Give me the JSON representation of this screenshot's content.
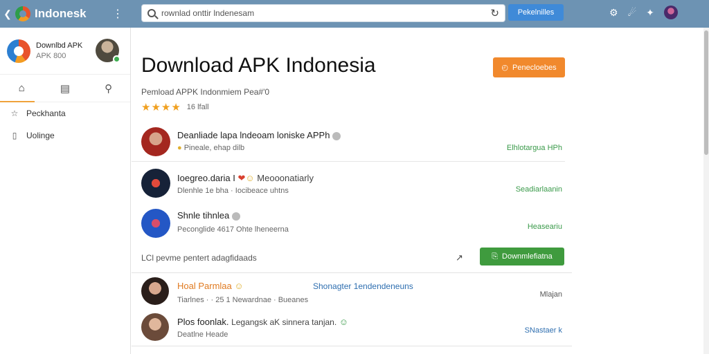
{
  "topbar": {
    "brand": "Indonesk",
    "search_value": "rownlad onttir lndenesam",
    "button_label": "Pekelnilles"
  },
  "sidebar": {
    "profile_title": "Downlbd APK",
    "profile_sub": "APK 800",
    "items": [
      {
        "label": "Peckhanta",
        "icon": "star-icon"
      },
      {
        "label": "Uolinge",
        "icon": "device-icon"
      }
    ]
  },
  "main": {
    "title": "Download APK Indonesia",
    "orange_button": "Penecloebes",
    "subtitle": "Pemload APPK Indonmiem Pea#'0",
    "stars": "★★★★",
    "rating_count": "16 lfall",
    "rows": [
      {
        "title": "Deanliade lapa lndeoam loniske APPh",
        "sub": "Pineale, ehap dilb",
        "meta": "Elhlotargua HPh"
      },
      {
        "title": "Ioegreo.daria I",
        "title2": "Meooonatiarly",
        "sub": "Dlenhle 1e bha · Iocibeace uhtns",
        "meta": "Seadiarlaanin"
      },
      {
        "title": "Shnle tihnlea",
        "sub": "Peconglide 4617 Ohte lheneerna",
        "meta": "Heaseariu"
      }
    ],
    "availability": "LCl pevme pentert adagfidaads",
    "download_button": "Downmlefiatna",
    "comments": [
      {
        "name": "Hoal Parmlaa",
        "tag": "Shonagter 1endendeneuns",
        "sub": "Tiarlnes · · 25 1 Newardnae · Bueanes",
        "meta": "Mlajan"
      },
      {
        "name": "Plos foonlak.",
        "body": "Legangsk aK sinnera tanjan.",
        "sub": "Deatlne Heade",
        "meta": "SNastaer k"
      }
    ]
  },
  "colors": {
    "topbar": "#6d93b3",
    "accent_blue": "#3f8ad8",
    "accent_orange": "#f1892d",
    "accent_green": "#3f9b3e"
  }
}
